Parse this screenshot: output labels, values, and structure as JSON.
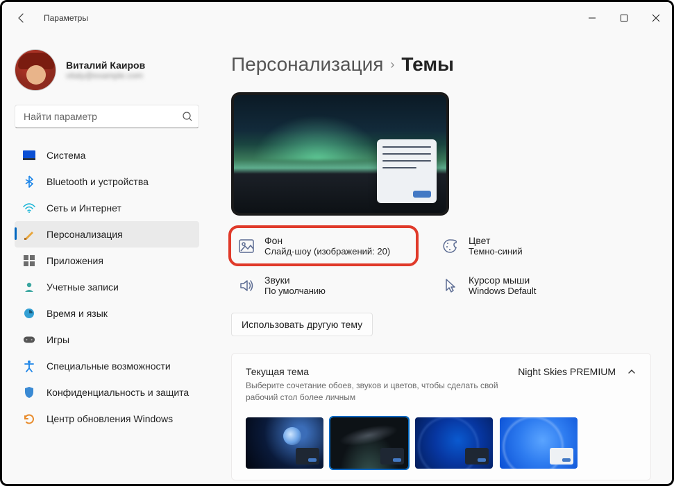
{
  "window": {
    "title": "Параметры"
  },
  "profile": {
    "name": "Виталий Каиров",
    "email": "vitaly@example.com"
  },
  "search": {
    "placeholder": "Найти параметр"
  },
  "nav": [
    {
      "label": "Система",
      "icon": "system"
    },
    {
      "label": "Bluetooth и устройства",
      "icon": "bluetooth"
    },
    {
      "label": "Сеть и Интернет",
      "icon": "network"
    },
    {
      "label": "Персонализация",
      "icon": "personalization",
      "active": true
    },
    {
      "label": "Приложения",
      "icon": "apps"
    },
    {
      "label": "Учетные записи",
      "icon": "accounts"
    },
    {
      "label": "Время и язык",
      "icon": "time"
    },
    {
      "label": "Игры",
      "icon": "gaming"
    },
    {
      "label": "Специальные возможности",
      "icon": "accessibility"
    },
    {
      "label": "Конфиденциальность и защита",
      "icon": "privacy"
    },
    {
      "label": "Центр обновления Windows",
      "icon": "update"
    }
  ],
  "breadcrumb": {
    "root": "Персонализация",
    "leaf": "Темы"
  },
  "tiles": {
    "background": {
      "title": "Фон",
      "sub": "Слайд-шоу (изображений: 20)"
    },
    "color": {
      "title": "Цвет",
      "sub": "Темно-синий"
    },
    "sounds": {
      "title": "Звуки",
      "sub": "По умолчанию"
    },
    "cursor": {
      "title": "Курсор мыши",
      "sub": "Windows Default"
    }
  },
  "button_other_theme": "Использовать другую тему",
  "current_theme": {
    "title": "Текущая тема",
    "sub": "Выберите сочетание обоев, звуков и цветов, чтобы сделать свой рабочий стол более личным",
    "selected_name": "Night Skies PREMIUM"
  }
}
